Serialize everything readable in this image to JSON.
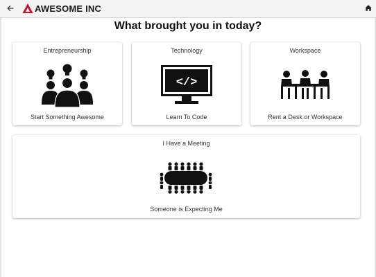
{
  "header": {
    "back_icon": "arrow-left-icon",
    "brand": "AWESOME INC",
    "brand_color": "#c8102e",
    "home_icon": "home-icon"
  },
  "main": {
    "title": "What brought you in today?",
    "cards": [
      {
        "title": "Entrepreneurship",
        "subtitle": "Start Something Awesome",
        "icon": "lightbulb-people-icon"
      },
      {
        "title": "Technology",
        "subtitle": "Learn To Code",
        "icon": "code-monitor-icon"
      },
      {
        "title": "Workspace",
        "subtitle": "Rent a Desk or Workspace",
        "icon": "workspace-desk-icon"
      },
      {
        "title": "I Have a Meeting",
        "subtitle": "Someone is Expecting Me",
        "icon": "conference-table-icon"
      }
    ]
  }
}
